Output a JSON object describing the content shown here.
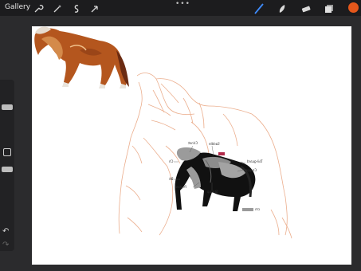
{
  "toolbar": {
    "gallery_label": "Gallery",
    "more_label": "•••",
    "left_tools": [
      "wrench-icon",
      "magic-wand-icon",
      "selection-icon",
      "transform-icon"
    ],
    "right_tools": [
      "brush-icon",
      "smudge-icon",
      "eraser-icon",
      "layers-icon"
    ],
    "color": "#e4571b",
    "active_color": "#3f8cff"
  },
  "sidebar": {
    "undo_label": "↶",
    "redo_label": "↷"
  },
  "canvas": {
    "labels": {
      "saddle": "Saddle",
      "crinet": "Crinet",
      "tail_guard": "Tail-guard",
      "crupper": "Crupper",
      "peytral": "Peytral",
      "stirrup": "Stirrup",
      "chanfron": "Ch",
      "bit": "Bit",
      "scale": "cm"
    }
  }
}
